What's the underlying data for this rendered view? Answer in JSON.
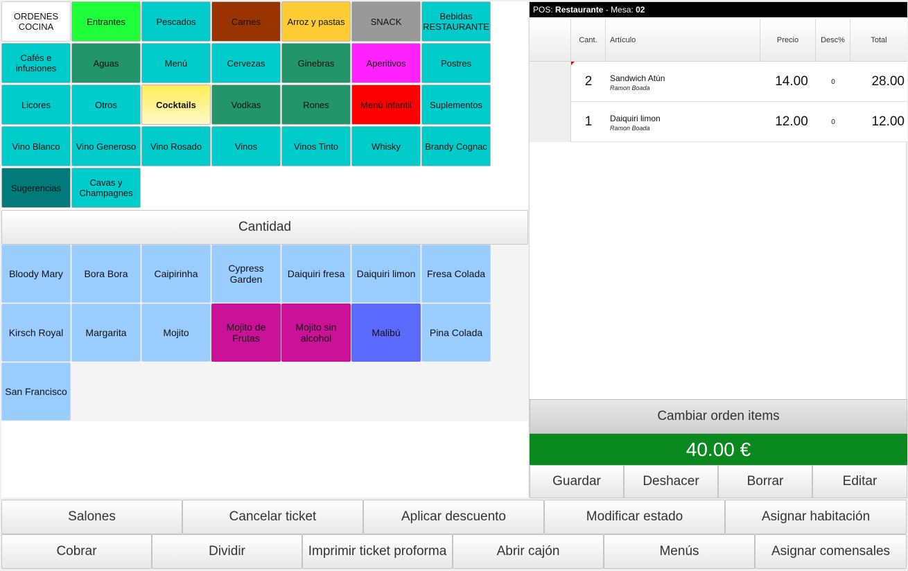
{
  "categories": [
    {
      "label": "ORDENES COCINA",
      "color": "#ffffff",
      "text": "#111111",
      "bold": false
    },
    {
      "label": "Entrantes",
      "color": "#1eff3a",
      "text": "#111111",
      "bold": false
    },
    {
      "label": "Pescados",
      "color": "#00cccc",
      "text": "#111111",
      "bold": false
    },
    {
      "label": "Carnes",
      "color": "#993300",
      "text": "#111111",
      "bold": false
    },
    {
      "label": "Arroz y pastas",
      "color": "#ffcc33",
      "text": "#111111",
      "bold": false
    },
    {
      "label": "SNACK",
      "color": "#999999",
      "text": "#111111",
      "bold": false
    },
    {
      "label": "Bebidas RESTAURANTE",
      "color": "#00cccc",
      "text": "#111111",
      "bold": false
    },
    {
      "label": "Cafés e infusiones",
      "color": "#00cccc",
      "text": "#111111",
      "bold": false
    },
    {
      "label": "Aguas",
      "color": "#22956a",
      "text": "#111111",
      "bold": false
    },
    {
      "label": "Menú",
      "color": "#00cccc",
      "text": "#111111",
      "bold": false
    },
    {
      "label": "Cervezas",
      "color": "#00cccc",
      "text": "#111111",
      "bold": false
    },
    {
      "label": "Ginebras",
      "color": "#22956a",
      "text": "#111111",
      "bold": false
    },
    {
      "label": "Aperitivos",
      "color": "#ff22ff",
      "text": "#111111",
      "bold": false
    },
    {
      "label": "Postres",
      "color": "#00cccc",
      "text": "#111111",
      "bold": false
    },
    {
      "label": "Licores",
      "color": "#00cccc",
      "text": "#111111",
      "bold": false
    },
    {
      "label": "Otros",
      "color": "#00cccc",
      "text": "#111111",
      "bold": false
    },
    {
      "label": "Cocktails",
      "color": "#ffee66",
      "text": "#111111",
      "bold": true
    },
    {
      "label": "Vodkas",
      "color": "#22956a",
      "text": "#111111",
      "bold": false
    },
    {
      "label": "Rones",
      "color": "#22956a",
      "text": "#111111",
      "bold": false
    },
    {
      "label": "Menú infantil",
      "color": "#ff0000",
      "text": "#111111",
      "bold": false
    },
    {
      "label": "Suplementos",
      "color": "#00cccc",
      "text": "#111111",
      "bold": false
    },
    {
      "label": "Vino Blanco",
      "color": "#00cccc",
      "text": "#111111",
      "bold": false
    },
    {
      "label": "Vino Generoso",
      "color": "#00cccc",
      "text": "#111111",
      "bold": false
    },
    {
      "label": "Vino Rosado",
      "color": "#00cccc",
      "text": "#111111",
      "bold": false
    },
    {
      "label": "Vinos",
      "color": "#00cccc",
      "text": "#111111",
      "bold": false
    },
    {
      "label": "Vinos Tinto",
      "color": "#00cccc",
      "text": "#111111",
      "bold": false
    },
    {
      "label": "Whisky",
      "color": "#00cccc",
      "text": "#111111",
      "bold": false
    },
    {
      "label": "Brandy Cognac",
      "color": "#00cccc",
      "text": "#111111",
      "bold": false
    },
    {
      "label": "Sugerencias",
      "color": "#007a7a",
      "text": "#111111",
      "bold": false
    },
    {
      "label": "Cavas y Champagnes",
      "color": "#00cccc",
      "text": "#111111",
      "bold": false
    }
  ],
  "quantity_label": "Cantidad",
  "products": [
    {
      "label": "Bloody Mary",
      "color": "#99ccff"
    },
    {
      "label": "Bora Bora",
      "color": "#99ccff"
    },
    {
      "label": "Caipirinha",
      "color": "#99ccff"
    },
    {
      "label": "Cypress Garden",
      "color": "#99ccff"
    },
    {
      "label": "Daiquiri fresa",
      "color": "#99ccff"
    },
    {
      "label": "Daiquiri limon",
      "color": "#99ccff"
    },
    {
      "label": "Fresa Colada",
      "color": "#99ccff"
    },
    {
      "label": "Kirsch Royal",
      "color": "#99ccff"
    },
    {
      "label": "Margarita",
      "color": "#99ccff"
    },
    {
      "label": "Mojito",
      "color": "#99ccff"
    },
    {
      "label": "Mojito de Frutas",
      "color": "#cc1199"
    },
    {
      "label": "Mojito sin alcohol",
      "color": "#cc1199"
    },
    {
      "label": "Malibú",
      "color": "#5b6bff"
    },
    {
      "label": "Pina Colada",
      "color": "#99ccff"
    },
    {
      "label": "San Francisco",
      "color": "#99ccff"
    }
  ],
  "ticket": {
    "pos_label": "POS:",
    "pos_value": "Restaurante",
    "table_label": "- Mesa:",
    "table_value": "02",
    "columns": {
      "qty": "Cant.",
      "article": "Artículo",
      "price": "Precio",
      "discount": "Desc%",
      "total": "Total"
    },
    "rows": [
      {
        "qty": "2",
        "name": "Sandwich Atún",
        "waiter": "Ramon Boada",
        "price": "14.00",
        "discount": "0",
        "total": "28.00"
      },
      {
        "qty": "1",
        "name": "Daiquiri limon",
        "waiter": "Ramon Boada",
        "price": "12.00",
        "discount": "0",
        "total": "12.00"
      }
    ],
    "change_order_label": "Cambiar orden items",
    "total_display": "40.00 €",
    "actions": {
      "save": "Guardar",
      "undo": "Deshacer",
      "delete": "Borrar",
      "edit": "Editar"
    }
  },
  "toolbar_top": [
    "Salones",
    "Cancelar ticket",
    "Aplicar descuento",
    "Modificar estado",
    "Asignar habitación"
  ],
  "toolbar_bottom": [
    "Cobrar",
    "Dividir",
    "Imprimir ticket proforma",
    "Abrir cajón",
    "Menús",
    "Asignar comensales"
  ]
}
